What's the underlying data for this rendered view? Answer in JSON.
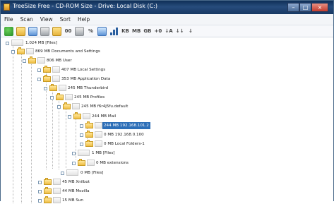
{
  "window": {
    "title": "TreeSize Free - CD-ROM Size - Drive: Local Disk (C:)"
  },
  "menu": [
    "File",
    "Scan",
    "View",
    "Sort",
    "Help"
  ],
  "toolbar": {
    "items": [
      {
        "name": "scan-icon",
        "kind": "green"
      },
      {
        "name": "folder-icon",
        "kind": "folder"
      },
      {
        "name": "refresh-icon",
        "kind": "blue"
      },
      {
        "name": "print-icon",
        "kind": "gray"
      },
      {
        "name": "open-icon",
        "kind": "folder"
      },
      {
        "name": "size-text",
        "kind": "text",
        "text": "00"
      },
      {
        "name": "chart-icon",
        "kind": "gray"
      },
      {
        "name": "percent-text",
        "kind": "text",
        "text": "%"
      },
      {
        "name": "tree-icon",
        "kind": "blue"
      },
      {
        "name": "bars-icon",
        "kind": "bars"
      },
      {
        "name": "kb-text",
        "kind": "text",
        "text": "KB"
      },
      {
        "name": "mb-text",
        "kind": "text",
        "text": "MB"
      },
      {
        "name": "gb-text",
        "kind": "text",
        "text": "GB"
      },
      {
        "name": "arrow-text",
        "kind": "text",
        "text": "+0"
      },
      {
        "name": "sort-text",
        "kind": "text",
        "text": "↓A"
      },
      {
        "name": "sort-size-text",
        "kind": "text",
        "text": "↓↓"
      },
      {
        "name": "sort-down-text",
        "kind": "text",
        "text": "↓"
      }
    ]
  },
  "tree": [
    {
      "label": "1.024 MB [Files]",
      "selected": false
    },
    {
      "label": "869 MB Documents and Settings",
      "selected": false
    },
    {
      "label": "806 MB User",
      "selected": false
    },
    {
      "label": "407 MB Local Settings",
      "selected": false
    },
    {
      "label": "353 MB Application Data",
      "selected": false
    },
    {
      "label": "245 MB Thunderbird",
      "selected": false
    },
    {
      "label": "245 MB Profiles",
      "selected": false
    },
    {
      "label": "245 MB f6r4j5fu.default",
      "selected": false
    },
    {
      "label": "244 MB Mail",
      "selected": false
    },
    {
      "label": "244 MB 192.168.101.2",
      "selected": true
    },
    {
      "label": "0 MB 192.168.0.100",
      "selected": false
    },
    {
      "label": "0 MB Local Folders-1",
      "selected": false
    },
    {
      "label": "1 MB [Files]",
      "selected": false
    },
    {
      "label": "0 MB extensions",
      "selected": false
    },
    {
      "label": "0 MB [Files]",
      "selected": false
    },
    {
      "label": "45 MB Xnilbot",
      "selected": false
    },
    {
      "label": "44 MB Mozilla",
      "selected": false
    },
    {
      "label": "15 MB Sun",
      "selected": false
    }
  ]
}
